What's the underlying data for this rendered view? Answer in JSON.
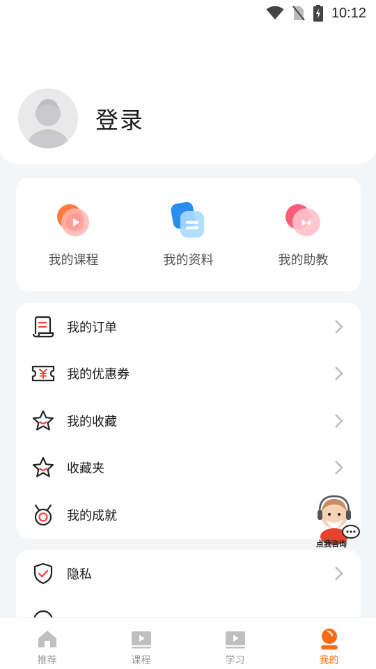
{
  "status_bar": {
    "time": "10:12"
  },
  "profile": {
    "login_label": "登录"
  },
  "quick_actions": [
    {
      "label": "我的课程",
      "icon": "play-course-icon"
    },
    {
      "label": "我的资料",
      "icon": "document-icon"
    },
    {
      "label": "我的助教",
      "icon": "chat-assistant-icon"
    }
  ],
  "menu": [
    {
      "label": "我的订单",
      "icon": "order-scroll-icon"
    },
    {
      "label": "我的优惠券",
      "icon": "coupon-yen-icon"
    },
    {
      "label": "我的收藏",
      "icon": "star-icon"
    },
    {
      "label": "收藏夹",
      "icon": "star-folder-icon"
    },
    {
      "label": "我的成就",
      "icon": "medal-icon"
    }
  ],
  "menu2": [
    {
      "label": "隐私",
      "icon": "shield-check-icon"
    }
  ],
  "mascot": {
    "label": "点我咨询"
  },
  "tabbar": [
    {
      "label": "推荐",
      "icon": "home-icon"
    },
    {
      "label": "课程",
      "icon": "video-icon"
    },
    {
      "label": "学习",
      "icon": "video-study-icon"
    },
    {
      "label": "我的",
      "icon": "profile-icon"
    }
  ],
  "colors": {
    "accent": "#ff6a13",
    "background": "#f4f5f7"
  }
}
